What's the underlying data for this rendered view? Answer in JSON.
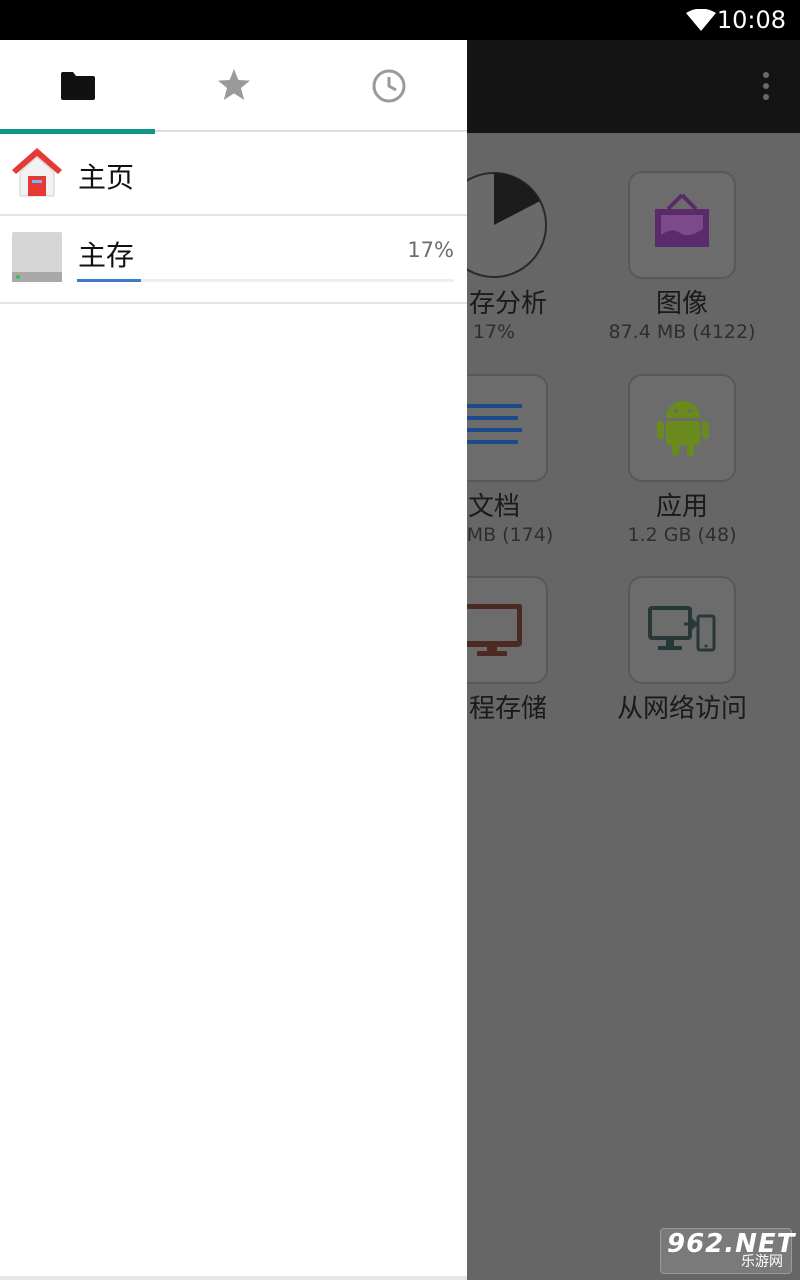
{
  "status_bar": {
    "time": "10:08"
  },
  "drawer": {
    "tabs": [
      {
        "icon": "folder-icon",
        "active": true
      },
      {
        "icon": "star-icon",
        "active": false
      },
      {
        "icon": "clock-icon",
        "active": false
      }
    ],
    "items": [
      {
        "icon": "home-icon",
        "label": "主页"
      },
      {
        "icon": "storage-icon",
        "label": "主存",
        "percent_text": "17%",
        "usage_fraction": 0.17
      }
    ]
  },
  "main": {
    "tiles": [
      {
        "icon": "pie-chart-icon",
        "label": "存分析",
        "sub": "17%"
      },
      {
        "icon": "image-icon",
        "label": "图像",
        "sub": "87.4 MB (4122)"
      },
      {
        "icon": "document-icon",
        "label": "文档",
        "sub": "MB (174)"
      },
      {
        "icon": "android-icon",
        "label": "应用",
        "sub": "1.2 GB (48)"
      },
      {
        "icon": "monitor-icon",
        "label": "程存储",
        "sub": ""
      },
      {
        "icon": "network-devices-icon",
        "label": "从网络访问",
        "sub": ""
      }
    ]
  },
  "watermark": {
    "top": "962.NET",
    "bottom": "乐游网"
  },
  "colors": {
    "accent": "#129688",
    "progress": "#3d79d3",
    "image_icon": "#5a2a6a",
    "android_icon": "#6b8a1e",
    "document_icon": "#1c4a8a",
    "monitor_icon": "#4a2a22"
  }
}
